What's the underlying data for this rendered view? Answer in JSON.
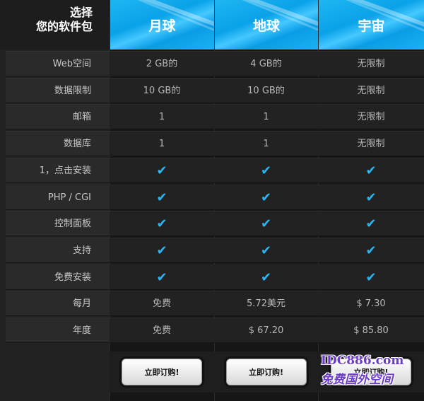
{
  "header": {
    "label_line1": "选择",
    "label_line2": "您的软件包"
  },
  "plans": [
    {
      "name": "月球",
      "buy_label": "立即订购!"
    },
    {
      "name": "地球",
      "buy_label": "立即订购!"
    },
    {
      "name": "宇宙",
      "buy_label": "立即订购!"
    }
  ],
  "rows": [
    {
      "label": "Web空间",
      "values": [
        "2 GB的",
        "4 GB的",
        "无限制"
      ]
    },
    {
      "label": "数据限制",
      "values": [
        "10 GB的",
        "10 GB的",
        "无限制"
      ]
    },
    {
      "label": "邮箱",
      "values": [
        "1",
        "1",
        "无限制"
      ]
    },
    {
      "label": "数据库",
      "values": [
        "1",
        "1",
        "无限制"
      ]
    },
    {
      "label": "1，点击安装",
      "values": [
        "✔",
        "✔",
        "✔"
      ]
    },
    {
      "label": "PHP / CGI",
      "values": [
        "✔",
        "✔",
        "✔"
      ]
    },
    {
      "label": "控制面板",
      "values": [
        "✔",
        "✔",
        "✔"
      ]
    },
    {
      "label": "支持",
      "values": [
        "✔",
        "✔",
        "✔"
      ]
    },
    {
      "label": "免费安装",
      "values": [
        "✔",
        "✔",
        "✔"
      ]
    },
    {
      "label": "每月",
      "values": [
        "免费",
        "5.72美元",
        "$ 7.30"
      ]
    },
    {
      "label": "年度",
      "values": [
        "免费",
        "$ 67.20",
        "$ 85.80"
      ]
    }
  ],
  "watermark": {
    "line1": "IDC886.com",
    "line2": "免费国外空间"
  },
  "colors": {
    "accent": "#29b6f2",
    "header_blue": "#0aa2e8"
  }
}
